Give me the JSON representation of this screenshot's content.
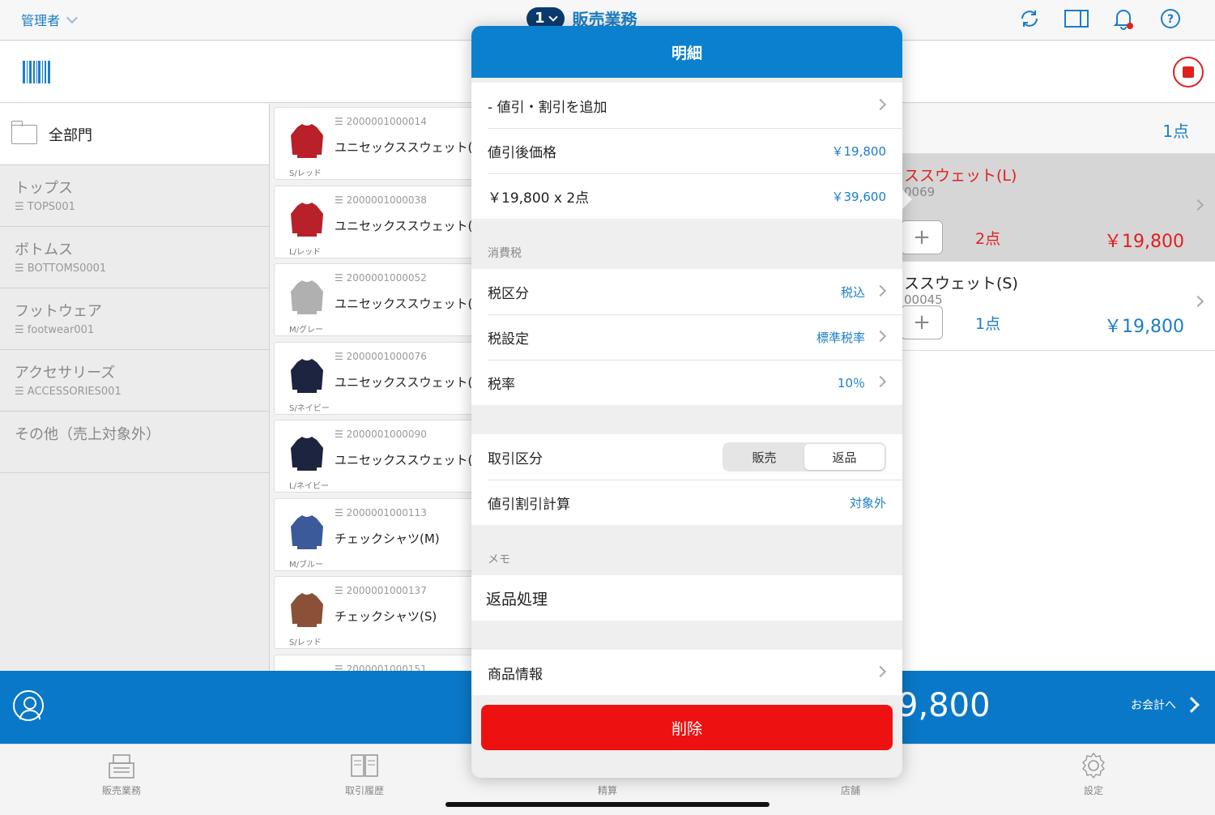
{
  "topbar": {
    "user": "管理者",
    "register_no": "1",
    "title": "販売業務"
  },
  "categories": {
    "all_label": "全部門",
    "items": [
      {
        "name": "トップス",
        "code": "TOPS001"
      },
      {
        "name": "ボトムス",
        "code": "BOTTOMS0001"
      },
      {
        "name": "フットウェア",
        "code": "footwear001"
      },
      {
        "name": "アクセサリーズ",
        "code": "ACCESSORIES001"
      },
      {
        "name": "その他（売上対象外）",
        "code": ""
      }
    ]
  },
  "products": [
    {
      "code": "2000001000014",
      "name": "ユニセックススウェット(S",
      "variant": "S/レッド",
      "color": "#b8202a"
    },
    {
      "code": "2000001000038",
      "name": "ユニセックススウェット(L",
      "variant": "L/レッド",
      "color": "#b8202a"
    },
    {
      "code": "2000001000052",
      "name": "ユニセックススウェット(M",
      "variant": "M/グレー",
      "color": "#b0b0b0"
    },
    {
      "code": "2000001000076",
      "name": "ユニセックススウェット(S",
      "variant": "S/ネイビー",
      "color": "#1c2440"
    },
    {
      "code": "2000001000090",
      "name": "ユニセックススウェット(L",
      "variant": "L/ネイビー",
      "color": "#1c2440"
    },
    {
      "code": "2000001000113",
      "name": "チェックシャツ(M)",
      "variant": "M/ブルー",
      "color": "#3a5a9a"
    },
    {
      "code": "2000001000137",
      "name": "チェックシャツ(S)",
      "variant": "S/レッド",
      "color": "#8a5038"
    },
    {
      "code": "2000001000151",
      "name": "",
      "variant": "",
      "color": "#999999"
    }
  ],
  "cart": {
    "count": "1点",
    "rows": [
      {
        "name": "ススウェット(L)",
        "code": "0069",
        "qty": "2点",
        "price": "￥19,800"
      },
      {
        "name": "ススウェット(S)",
        "code": "00045",
        "qty": "1点",
        "price": "￥19,800"
      }
    ]
  },
  "total": {
    "amount": "9,800",
    "checkout_label": "お会計へ"
  },
  "tabs": [
    {
      "label": "販売業務"
    },
    {
      "label": "取引履歴"
    },
    {
      "label": "精算"
    },
    {
      "label": "店舗"
    },
    {
      "label": "設定"
    }
  ],
  "modal": {
    "title": "明細",
    "discount_add": "- 値引・割引を追加",
    "discounted_price_label": "値引後価格",
    "discounted_price": "￥19,800",
    "subtotal_label": "￥19,800 x 2点",
    "subtotal": "￥39,600",
    "tax_section": "消費税",
    "tax_type_label": "税区分",
    "tax_type": "税込",
    "tax_setting_label": "税設定",
    "tax_setting": "標準税率",
    "tax_rate_label": "税率",
    "tax_rate": "10％",
    "trade_type_label": "取引区分",
    "trade_sale": "販売",
    "trade_return": "返品",
    "discount_calc_label": "値引割引計算",
    "discount_calc": "対象外",
    "memo_section": "メモ",
    "memo": "返品処理",
    "product_info_label": "商品情報",
    "delete_label": "削除"
  },
  "colors": {
    "accent": "#0a80cf",
    "danger": "#ee1111"
  }
}
